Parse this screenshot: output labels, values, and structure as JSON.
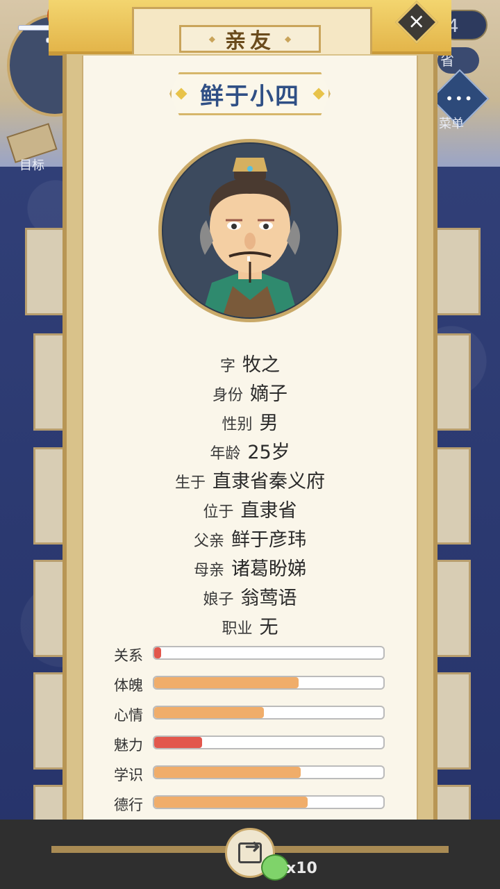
{
  "background": {
    "goal_label": "目标",
    "menu_label": "菜单",
    "menu_icon": "ellipsis-icon",
    "top_right_value": "4",
    "top_right_value2": "省"
  },
  "dialog": {
    "title": "亲友",
    "close_icon": "close-icon",
    "character_name": "鲜于小四",
    "info": [
      {
        "key": "字",
        "value": "牧之"
      },
      {
        "key": "身份",
        "value": "嫡子"
      },
      {
        "key": "性别",
        "value": "男"
      },
      {
        "key": "年龄",
        "value": "25岁"
      },
      {
        "key": "生于",
        "value": "直隶省秦义府"
      },
      {
        "key": "位于",
        "value": "直隶省"
      },
      {
        "key": "父亲",
        "value": "鲜于彦玮"
      },
      {
        "key": "母亲",
        "value": "诸葛盼娣"
      },
      {
        "key": "娘子",
        "value": "翁莺语"
      },
      {
        "key": "职业",
        "value": "无"
      }
    ],
    "stats": [
      {
        "label": "关系",
        "fraction": 0.03,
        "color": "#e2574c"
      },
      {
        "label": "体魄",
        "fraction": 0.63,
        "color": "#f0ad6a"
      },
      {
        "label": "心情",
        "fraction": 0.48,
        "color": "#f0ad6a"
      },
      {
        "label": "魅力",
        "fraction": 0.21,
        "color": "#e2574c"
      },
      {
        "label": "学识",
        "fraction": 0.64,
        "color": "#f0ad6a"
      },
      {
        "label": "德行",
        "fraction": 0.67,
        "color": "#f0ad6a"
      }
    ]
  },
  "footer": {
    "share_icon": "share-icon",
    "reward_icon": "frog-coin-icon",
    "reward_count": "x10"
  }
}
